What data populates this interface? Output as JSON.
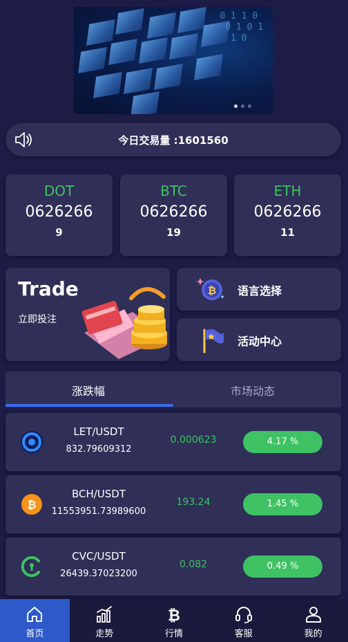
{
  "banner": {
    "digits": "0 1 1 0\n 0 1 0 1\n  1 0"
  },
  "notice": {
    "text": "今日交易量 :1601560"
  },
  "coins": [
    {
      "symbol": "DOT",
      "value": "0626266",
      "count": "9"
    },
    {
      "symbol": "BTC",
      "value": "0626266",
      "count": "19"
    },
    {
      "symbol": "ETH",
      "value": "0626266",
      "count": "11"
    }
  ],
  "trade": {
    "title": "Trade",
    "subtitle": "立即投注"
  },
  "actions": [
    {
      "label": "语言选择",
      "icon": "bitcoin-coin-icon"
    },
    {
      "label": "活动中心",
      "icon": "flag-icon"
    }
  ],
  "tabs": [
    {
      "label": "涨跌幅",
      "active": true
    },
    {
      "label": "市场动态",
      "active": false
    }
  ],
  "market": [
    {
      "pair": "LET/USDT",
      "volume": "832.79609312",
      "price": "0.000623",
      "change": "4.17 %",
      "icon": "let-coin-icon"
    },
    {
      "pair": "BCH/USDT",
      "volume": "11553951.73989600",
      "price": "193.24",
      "change": "1.45 %",
      "icon": "bitcoin-cash-icon"
    },
    {
      "pair": "CVC/USDT",
      "volume": "26439.37023200",
      "price": "0.082",
      "change": "0.49 %",
      "icon": "civic-coin-icon"
    }
  ],
  "nav": [
    {
      "label": "首页",
      "icon": "home-icon",
      "active": true
    },
    {
      "label": "走势",
      "icon": "trend-chart-icon",
      "active": false
    },
    {
      "label": "行情",
      "icon": "bitcoin-icon",
      "active": false
    },
    {
      "label": "客服",
      "icon": "headset-icon",
      "active": false
    },
    {
      "label": "我的",
      "icon": "user-icon",
      "active": false
    }
  ],
  "colors": {
    "background": "#1c1c46",
    "card": "#2f2f57",
    "green": "#3fc264",
    "accent_blue": "#2d59c9",
    "tab_underline": "#3a6cf0"
  }
}
